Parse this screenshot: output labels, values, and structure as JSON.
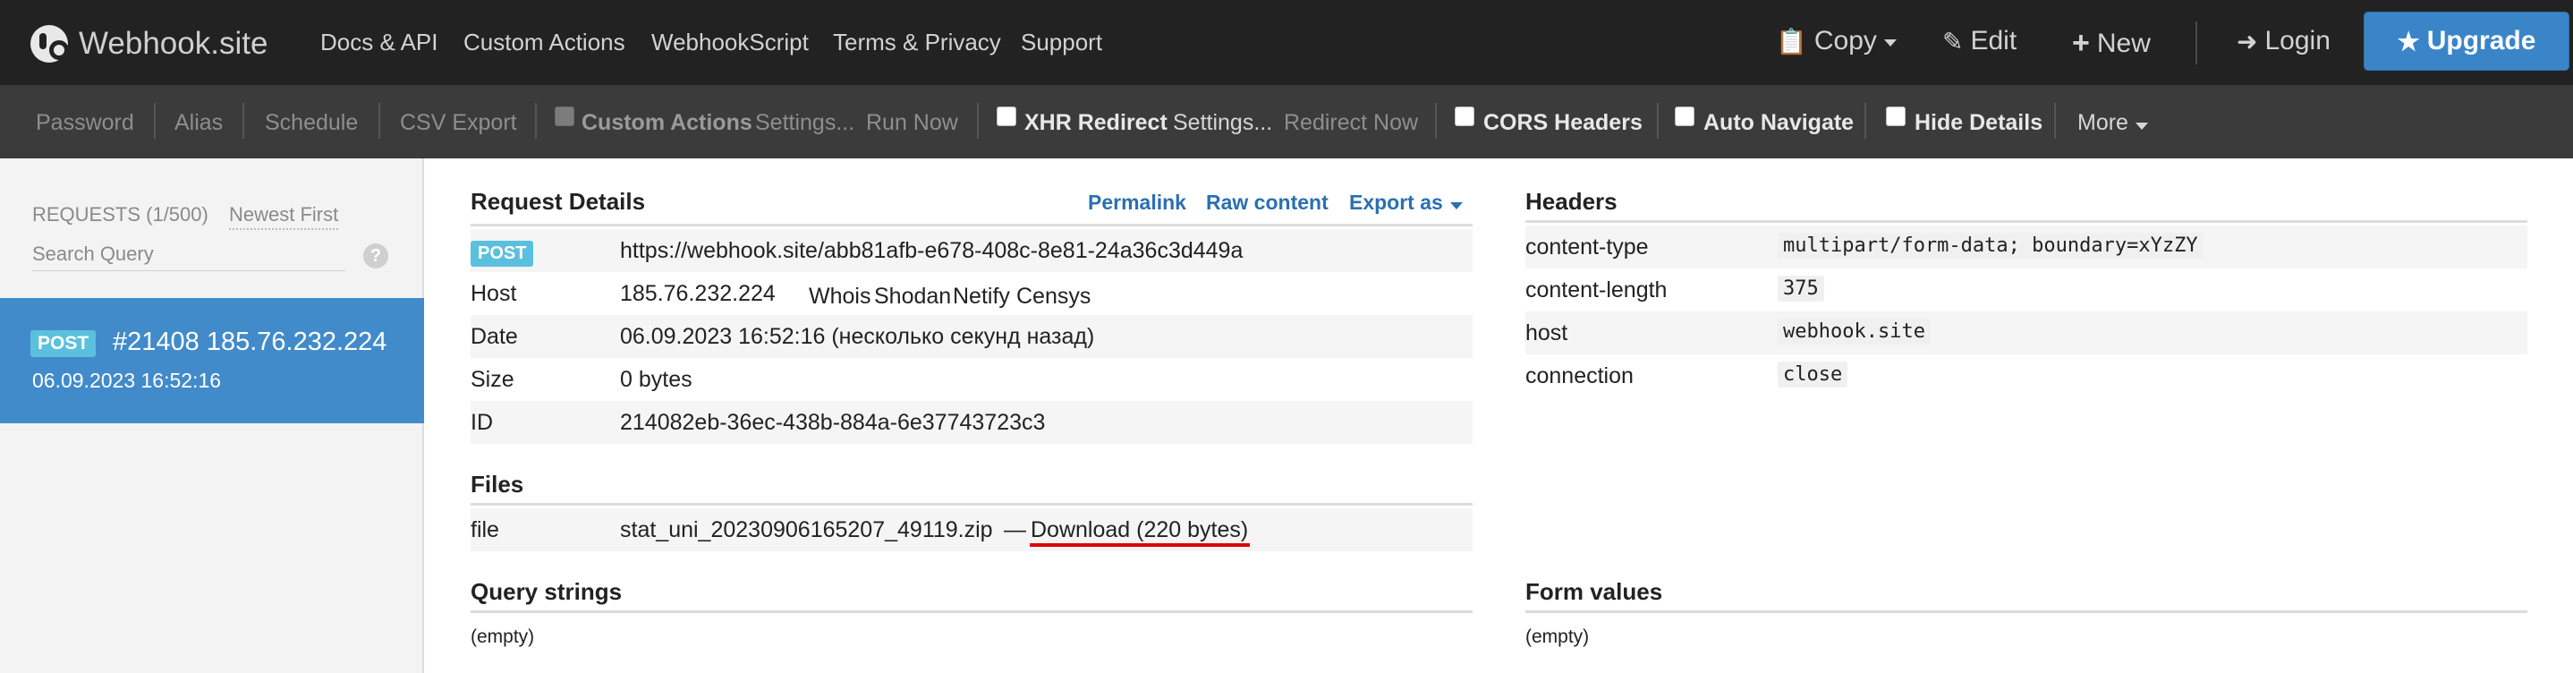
{
  "brand": {
    "name": "Webhook.site"
  },
  "topnav": {
    "links": [
      "Docs & API",
      "Custom Actions",
      "WebhookScript",
      "Terms & Privacy",
      "Support"
    ],
    "copy": "Copy",
    "edit": "Edit",
    "new": "New",
    "login": "Login",
    "upgrade": "Upgrade"
  },
  "toolbar": {
    "password": "Password",
    "alias": "Alias",
    "schedule": "Schedule",
    "csv_export": "CSV Export",
    "custom_actions": "Custom Actions",
    "settings1": "Settings...",
    "run_now": "Run Now",
    "xhr_redirect": "XHR Redirect",
    "settings2": "Settings...",
    "redirect_now": "Redirect Now",
    "cors_headers": "CORS Headers",
    "auto_navigate": "Auto Navigate",
    "hide_details": "Hide Details",
    "more": "More"
  },
  "sidebar": {
    "count": "REQUESTS (1/500)",
    "sort": "Newest First",
    "search_placeholder": "Search Query",
    "help": "?",
    "requests": [
      {
        "method": "POST",
        "title": "#21408 185.76.232.224",
        "date": "06.09.2023 16:52:16"
      }
    ]
  },
  "request_details": {
    "title": "Request Details",
    "actions": {
      "permalink": "Permalink",
      "raw": "Raw content",
      "export": "Export as"
    },
    "method": "POST",
    "url": "https://webhook.site/abb81afb-e678-408c-8e81-24a36c3d449a",
    "host_label": "Host",
    "host": "185.76.232.224",
    "host_links": [
      "Whois",
      "Shodan",
      "Netify",
      "Censys"
    ],
    "date_label": "Date",
    "date": "06.09.2023 16:52:16 (несколько секунд назад)",
    "size_label": "Size",
    "size": "0 bytes",
    "id_label": "ID",
    "id": "214082eb-36ec-438b-884a-6e37743723c3"
  },
  "files": {
    "title": "Files",
    "label": "file",
    "name": "stat_uni_20230906165207_49119.zip",
    "dash": "—",
    "download": "Download (220 bytes)"
  },
  "query_strings": {
    "title": "Query strings",
    "value": "(empty)"
  },
  "headers": {
    "title": "Headers",
    "rows": [
      {
        "key": "content-type",
        "value": "multipart/form-data; boundary=xYzZY"
      },
      {
        "key": "content-length",
        "value": "375"
      },
      {
        "key": "host",
        "value": "webhook.site"
      },
      {
        "key": "connection",
        "value": "close"
      }
    ]
  },
  "form_values": {
    "title": "Form values",
    "value": "(empty)"
  },
  "colors": {
    "accent": "#428bca",
    "badge": "#5bc0de",
    "link": "#2a6fb3",
    "annotation": "#e00000"
  }
}
